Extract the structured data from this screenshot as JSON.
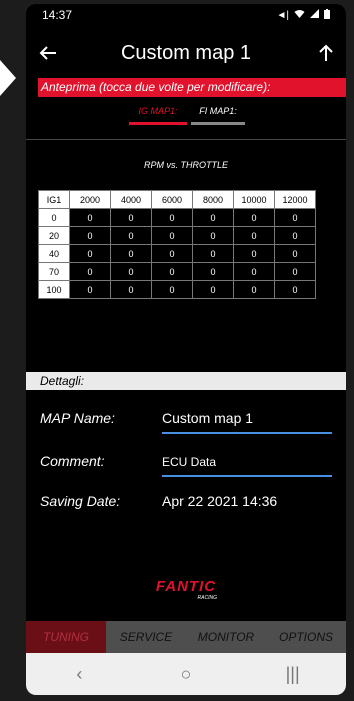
{
  "status_bar": {
    "time": "14:37",
    "icons": [
      "vibrate-icon",
      "wifi-icon",
      "signal-icon",
      "battery-icon"
    ]
  },
  "app_bar": {
    "title": "Custom map 1",
    "back_icon": "arrow-left-icon",
    "action_icon": "arrow-up-icon"
  },
  "preview_banner": "Anteprima (tocca due volte per modificare):",
  "map_tabs": [
    {
      "label": "IG MAP1:",
      "active": true
    },
    {
      "label": "FI MAP1:",
      "active": false
    }
  ],
  "chart_title": "RPM vs. THROTTLE",
  "table": {
    "header": [
      "IG1",
      "2000",
      "4000",
      "6000",
      "8000",
      "10000",
      "12000"
    ],
    "rows": [
      {
        "label": "0",
        "values": [
          "0",
          "0",
          "0",
          "0",
          "0",
          "0"
        ]
      },
      {
        "label": "20",
        "values": [
          "0",
          "0",
          "0",
          "0",
          "0",
          "0"
        ]
      },
      {
        "label": "40",
        "values": [
          "0",
          "0",
          "0",
          "0",
          "0",
          "0"
        ]
      },
      {
        "label": "70",
        "values": [
          "0",
          "0",
          "0",
          "0",
          "0",
          "0"
        ]
      },
      {
        "label": "100",
        "values": [
          "0",
          "0",
          "0",
          "0",
          "0",
          "0"
        ]
      }
    ]
  },
  "details": {
    "section_title": "Dettagli:",
    "map_name_label": "MAP Name:",
    "map_name_value": "Custom map 1",
    "comment_label": "Comment:",
    "comment_value": "ECU Data",
    "saving_date_label": "Saving Date:",
    "saving_date_value": "Apr 22 2021 14:36"
  },
  "logo": {
    "text": "FANTIC",
    "subtext": "RACING"
  },
  "bottom_nav": [
    {
      "label": "TUNING",
      "active": true
    },
    {
      "label": "SERVICE",
      "active": false
    },
    {
      "label": "MONITOR",
      "active": false
    },
    {
      "label": "OPTIONS",
      "active": false
    }
  ],
  "system_nav": {
    "back": "‹",
    "home": "○",
    "recents": "|||"
  },
  "colors": {
    "accent": "#e0122c",
    "underline": "#4a90e2",
    "nav_bg": "#4e4e4e"
  }
}
